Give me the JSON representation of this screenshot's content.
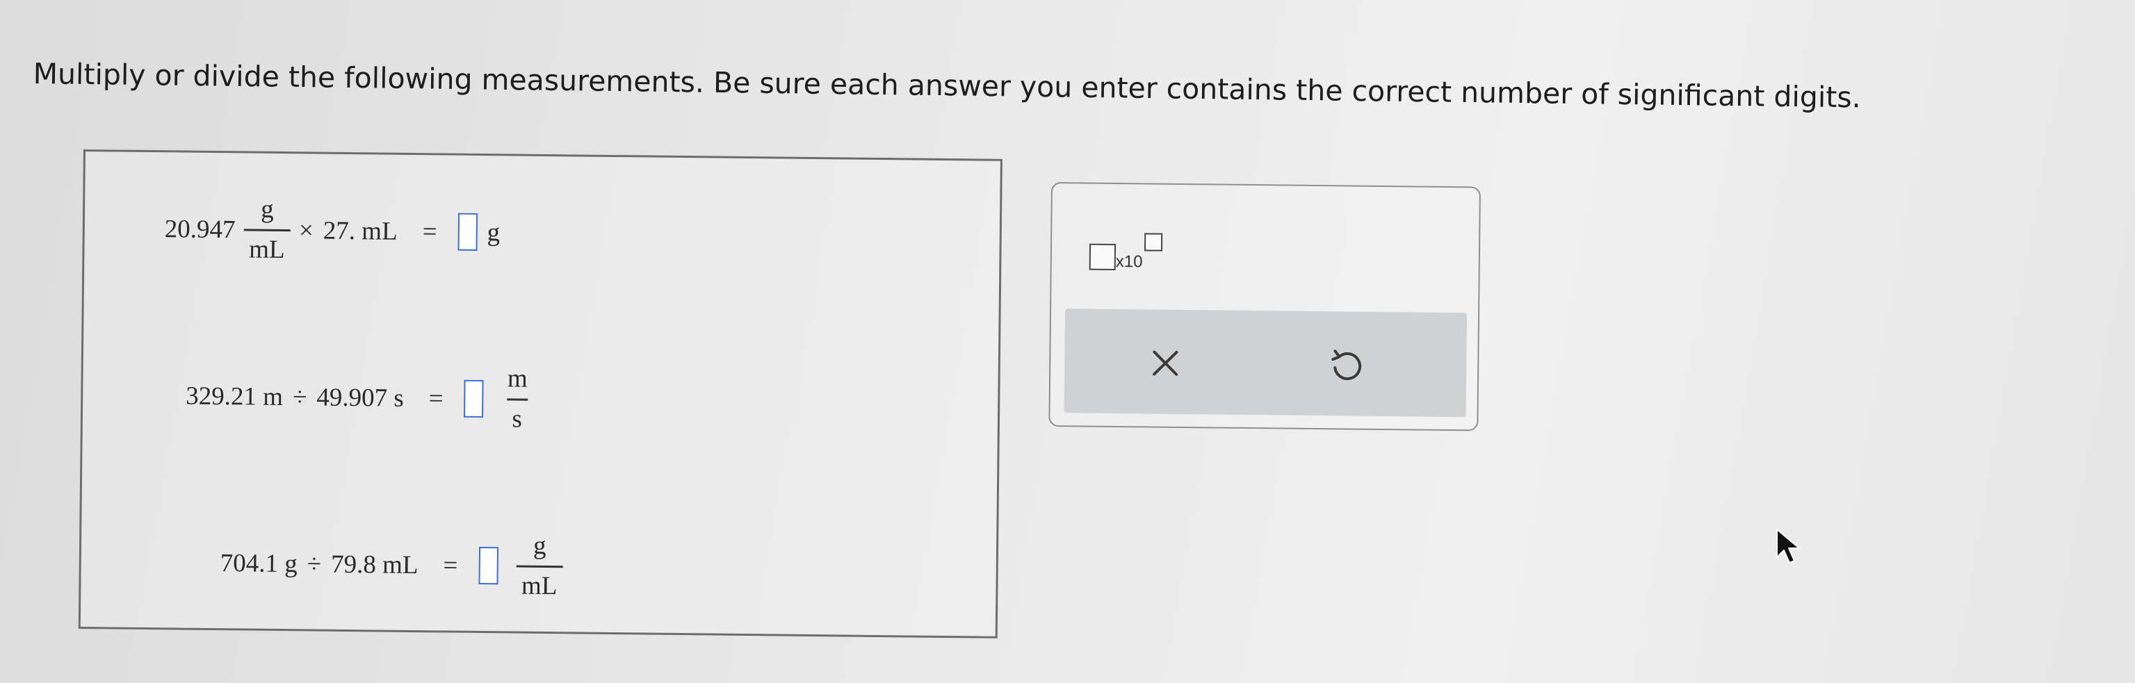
{
  "instructions": "Multiply or divide the following measurements. Be sure each answer you enter contains the correct number of significant digits.",
  "problems": [
    {
      "lhs_value": "20.947",
      "lhs_frac_num": "g",
      "lhs_frac_den": "mL",
      "operator": "×",
      "rhs": "27. mL",
      "equals": "=",
      "answer_value": "",
      "answer_unit": "g"
    },
    {
      "lhs": "329.21 m",
      "operator": "÷",
      "rhs": "49.907 s",
      "equals": "=",
      "answer_value": "",
      "answer_unit_num": "m",
      "answer_unit_den": "s"
    },
    {
      "lhs": "704.1 g",
      "operator": "÷",
      "rhs": "79.8 mL",
      "equals": "=",
      "answer_value": "",
      "answer_unit_num": "g",
      "answer_unit_den": "mL"
    }
  ],
  "tools": {
    "sci_notation_label": "x10",
    "clear_icon": "x-icon",
    "undo_icon": "undo-icon"
  },
  "colors": {
    "input_border": "#3b6fd6",
    "action_bar": "#cfd1d2"
  }
}
